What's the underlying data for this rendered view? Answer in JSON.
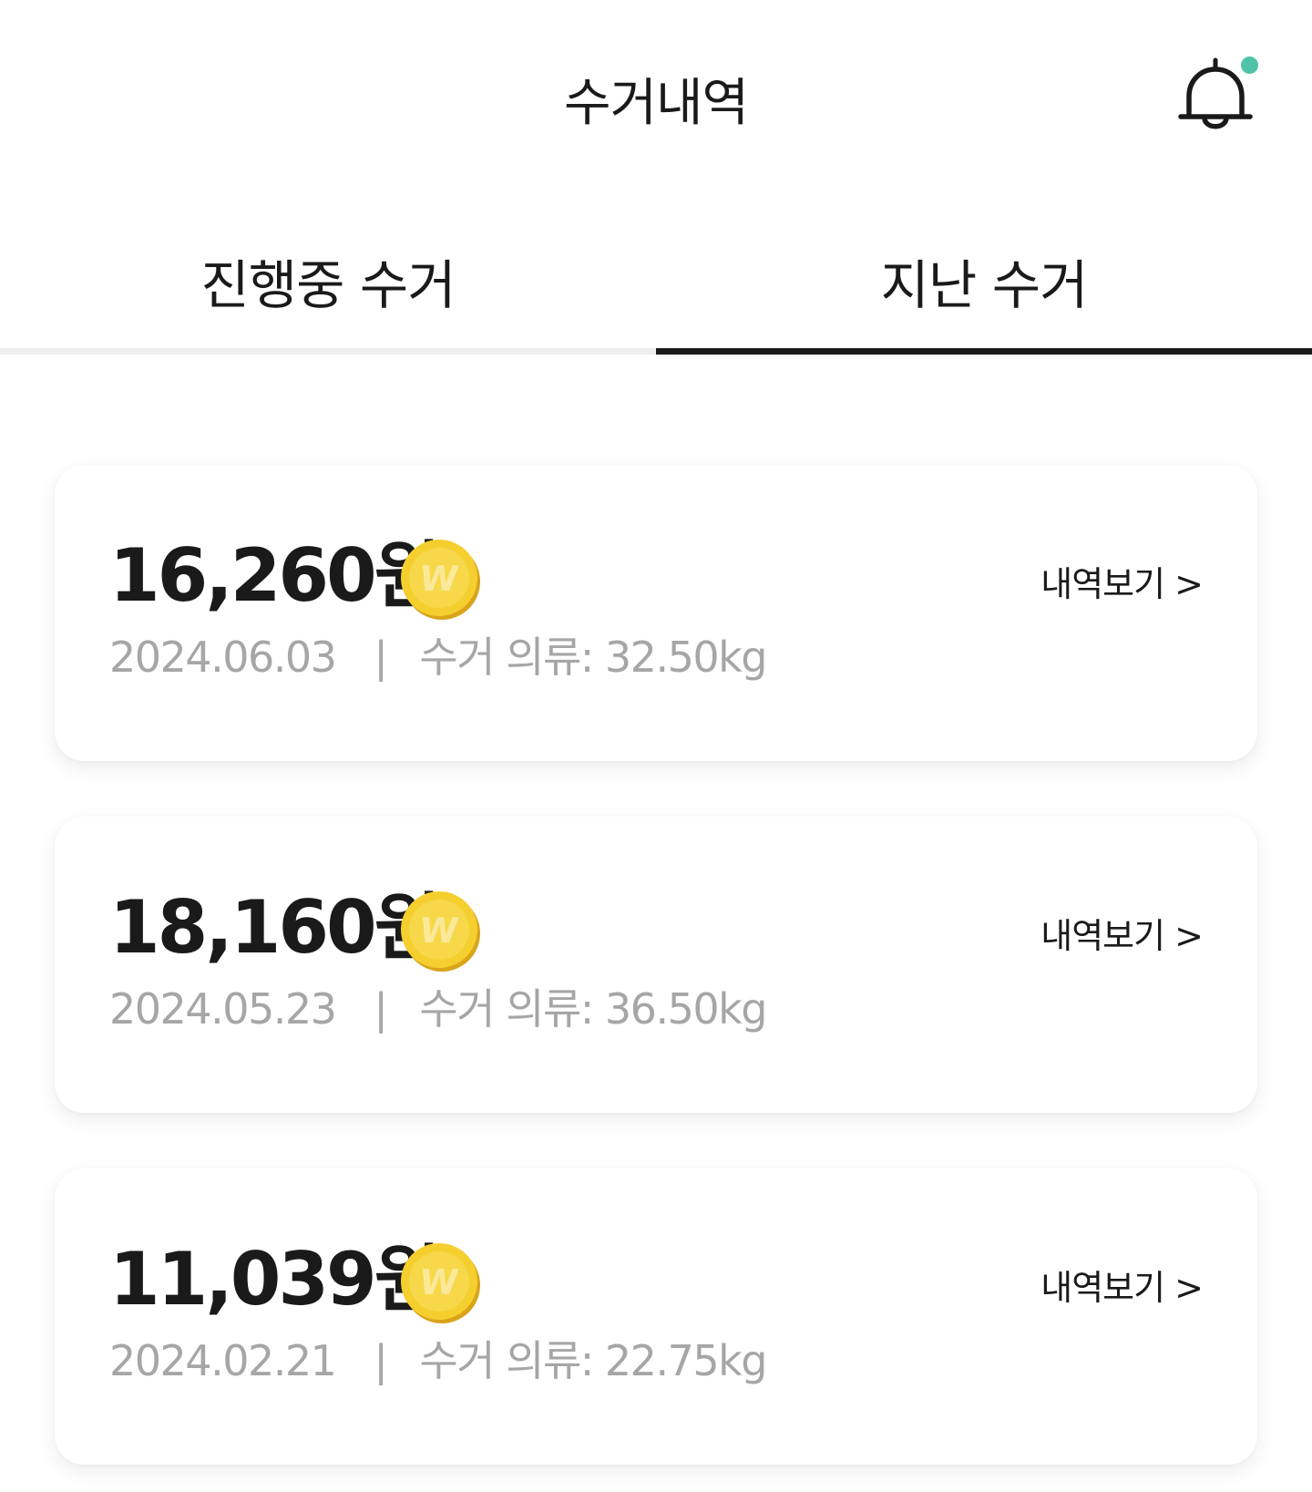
{
  "header": {
    "title": "수거내역",
    "bell_icon": "bell-icon",
    "notification_dot_color": "#4fc3a8"
  },
  "tabs": [
    {
      "label": "진행중 수거",
      "active": false
    },
    {
      "label": "지난 수거",
      "active": true
    }
  ],
  "records": [
    {
      "amount": "16,260원",
      "date": "2024.06.03",
      "separator": "|",
      "weight_label": "수거 의류: 32.50kg",
      "detail_label": "내역보기 >",
      "coin_icon": "coin-w-icon"
    },
    {
      "amount": "18,160원",
      "date": "2024.05.23",
      "separator": "|",
      "weight_label": "수거 의류: 36.50kg",
      "detail_label": "내역보기 >",
      "coin_icon": "coin-w-icon"
    },
    {
      "amount": "11,039원",
      "date": "2024.02.21",
      "separator": "|",
      "weight_label": "수거 의류: 22.75kg",
      "detail_label": "내역보기 >",
      "coin_icon": "coin-w-icon"
    }
  ],
  "colors": {
    "coin": "#f5cf2e",
    "muted_text": "#a6a6a6",
    "active_tab_indicator": "#1a1a1a"
  }
}
